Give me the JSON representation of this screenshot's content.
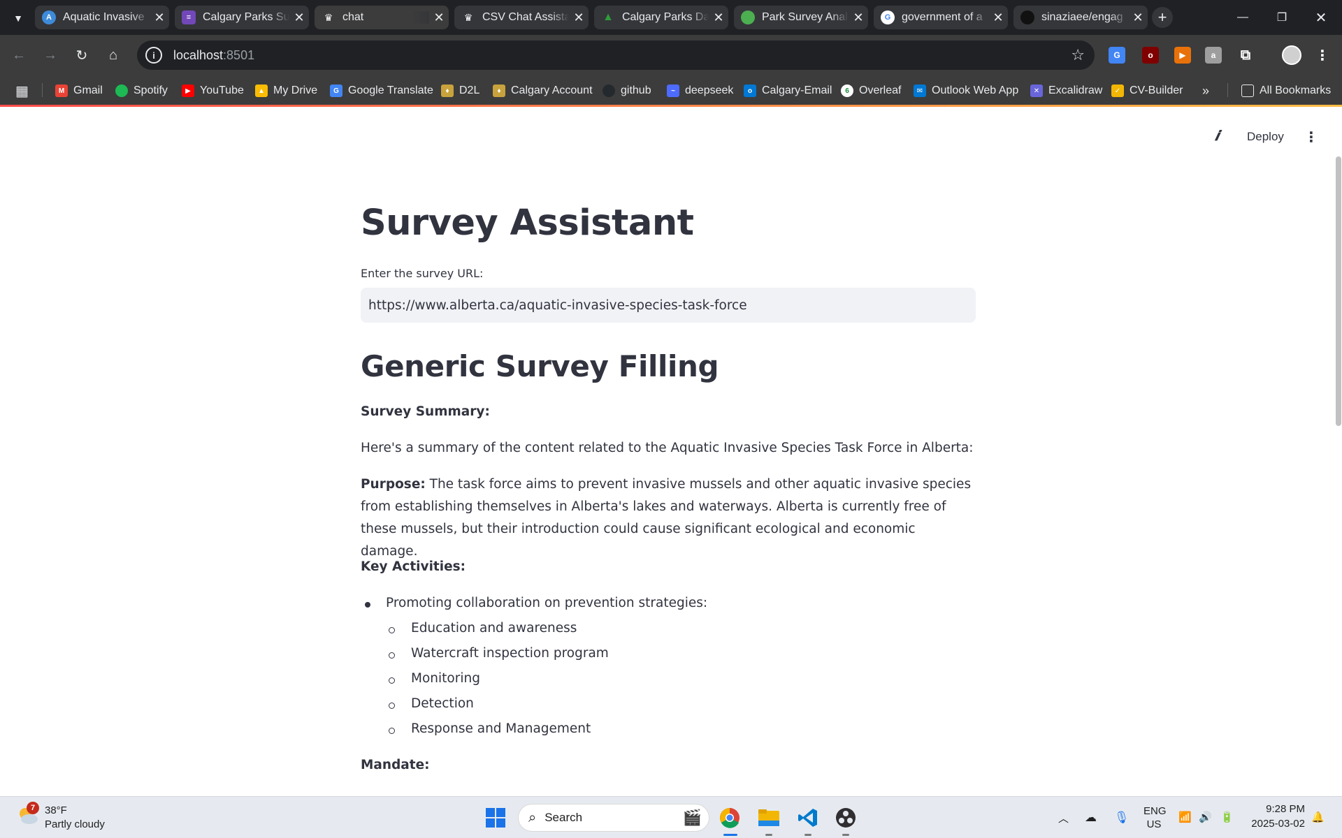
{
  "browser": {
    "tabs": [
      {
        "title": "Aquatic Invasive",
        "icon": "aquatic-favicon",
        "color": "#2b6cb0",
        "active": false
      },
      {
        "title": "Calgary Parks Su",
        "icon": "forms-favicon",
        "color": "#7248b9",
        "active": false
      },
      {
        "title": "chat",
        "icon": "crown-favicon",
        "color": "#ffffff",
        "active": true
      },
      {
        "title": "CSV Chat Assista",
        "icon": "crown-favicon",
        "color": "#ffffff",
        "active": false
      },
      {
        "title": "Calgary Parks Da",
        "icon": "tree-favicon",
        "color": "#2e7d32",
        "active": false
      },
      {
        "title": "Park Survey Anal",
        "icon": "tree-favicon",
        "color": "#4caf50",
        "active": false
      },
      {
        "title": "government of a",
        "icon": "google-favicon",
        "color": "#4285f4",
        "active": false
      },
      {
        "title": "sinaziaee/engag",
        "icon": "github-favicon",
        "color": "#24292e",
        "active": false
      }
    ],
    "address": {
      "host": "localhost",
      "port": ":8501"
    },
    "bookmarks": [
      {
        "label": "Gmail",
        "icon": "gmail-icon",
        "color": "#ea4335"
      },
      {
        "label": "Spotify",
        "icon": "spotify-icon",
        "color": "#1db954"
      },
      {
        "label": "YouTube",
        "icon": "youtube-icon",
        "color": "#ff0000"
      },
      {
        "label": "My Drive",
        "icon": "drive-icon",
        "color": "#fbbc04"
      },
      {
        "label": "Google Translate",
        "icon": "translate-icon",
        "color": "#4285f4"
      },
      {
        "label": "D2L",
        "icon": "shield-crest-icon",
        "color": "#c8a23c"
      },
      {
        "label": "Calgary Account",
        "icon": "shield-crest-icon",
        "color": "#c8a23c"
      },
      {
        "label": "github",
        "icon": "github-icon",
        "color": "#24292e"
      },
      {
        "label": "deepseek",
        "icon": "deepseek-icon",
        "color": "#4d6bfe"
      },
      {
        "label": "Calgary-Email",
        "icon": "outlook-icon",
        "color": "#0078d4"
      },
      {
        "label": "Overleaf",
        "icon": "overleaf-icon",
        "color": "#138a36"
      },
      {
        "label": "Outlook Web App",
        "icon": "owa-icon",
        "color": "#0078d4"
      },
      {
        "label": "Excalidraw",
        "icon": "excalidraw-icon",
        "color": "#6965db"
      },
      {
        "label": "CV-Builder",
        "icon": "cv-builder-icon",
        "color": "#f2b705"
      }
    ],
    "all_bookmarks": "All Bookmarks"
  },
  "app": {
    "deploy_label": "Deploy",
    "title": "Survey Assistant",
    "url_label": "Enter the survey URL:",
    "url_value": "https://www.alberta.ca/aquatic-invasive-species-task-force",
    "section_title": "Generic Survey Filling",
    "summary_heading": "Survey Summary:",
    "summary_intro": "Here's a summary of the content related to the Aquatic Invasive Species Task Force in Alberta:",
    "purpose_label": "Purpose:",
    "purpose_text": " The task force aims to prevent invasive mussels and other aquatic invasive species from establishing themselves in Alberta's lakes and waterways. Alberta is currently free of these mussels, but their introduction could cause significant ecological and economic damage.",
    "key_activities_heading": "Key Activities:",
    "activity_main": "Promoting collaboration on prevention strategies:",
    "activity_sub": [
      "Education and awareness",
      "Watercraft inspection program",
      "Monitoring",
      "Detection",
      "Response and Management"
    ],
    "mandate_heading": "Mandate:"
  },
  "taskbar": {
    "weather_temp": "38°F",
    "weather_desc": "Partly cloudy",
    "weather_badge": "7",
    "search_placeholder": "Search",
    "lang_top": "ENG",
    "lang_bottom": "US",
    "time": "9:28 PM",
    "date": "2025-03-02"
  }
}
